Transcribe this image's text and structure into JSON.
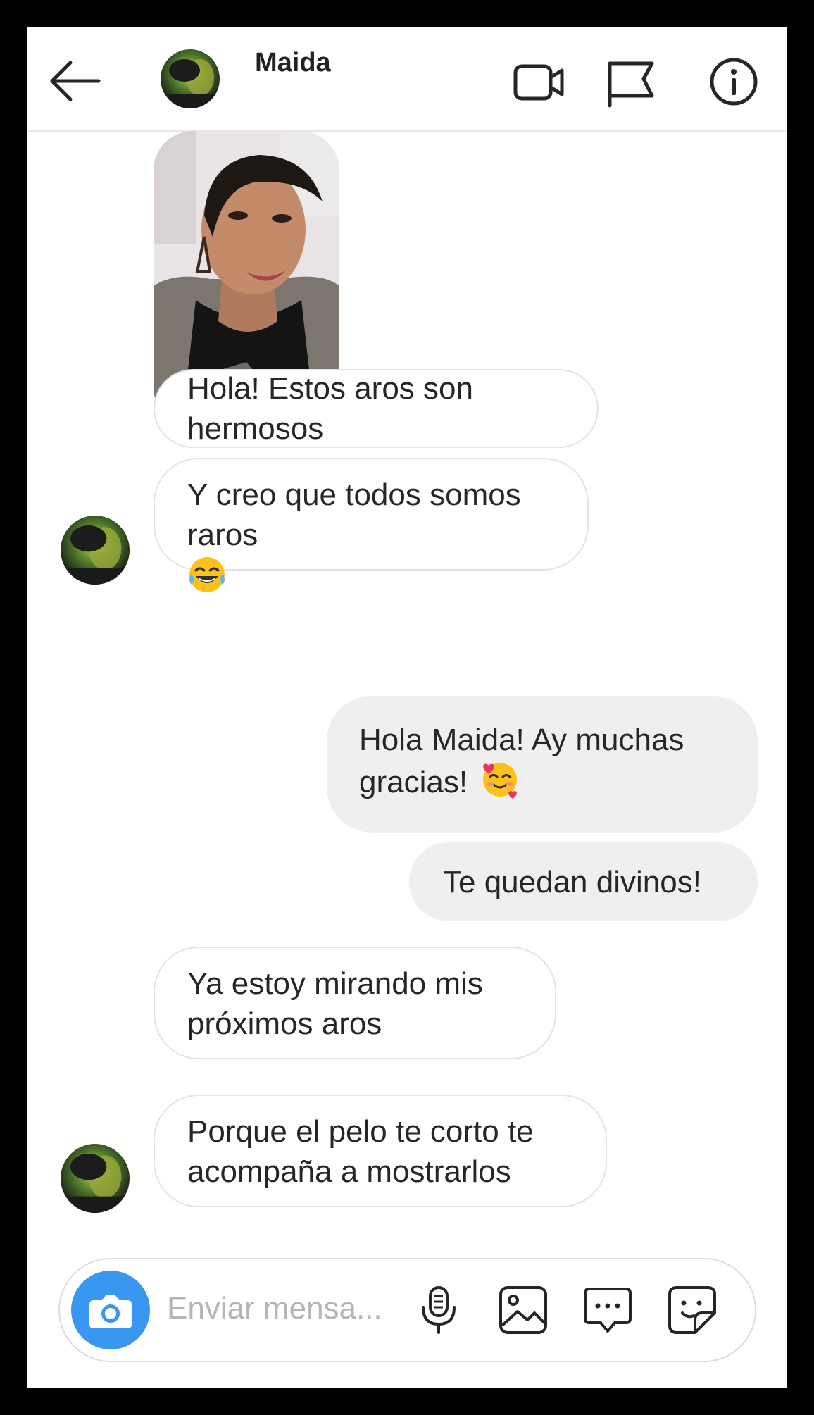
{
  "header": {
    "contact_name": "Maida",
    "icons": [
      "back-arrow-icon",
      "video-call-icon",
      "flag-icon",
      "info-icon"
    ]
  },
  "messages": [
    {
      "side": "in",
      "type": "photo"
    },
    {
      "side": "in",
      "text": "Hola! Estos aros son hermosos"
    },
    {
      "side": "in",
      "text": "Y creo que todos somos raros",
      "emoji": "tears-of-joy-emoji"
    },
    {
      "side": "out",
      "text": "Hola Maida! Ay muchas gracias!",
      "emoji": "smiling-face-with-hearts-emoji"
    },
    {
      "side": "out",
      "text": "Te quedan divinos!"
    },
    {
      "side": "in",
      "text": "Ya estoy mirando mis próximos aros"
    },
    {
      "side": "in",
      "text": "Porque el pelo te corto te acompaña a mostrarlos"
    }
  ],
  "composer": {
    "placeholder": "Enviar mensa...",
    "icons": [
      "camera-icon",
      "microphone-icon",
      "gallery-icon",
      "quick-reply-icon",
      "sticker-icon"
    ]
  },
  "colors": {
    "accent": "#3897f0",
    "incoming_bubble_border": "#e3e3e3",
    "outgoing_bubble_bg": "#efefef",
    "text": "#262626"
  }
}
